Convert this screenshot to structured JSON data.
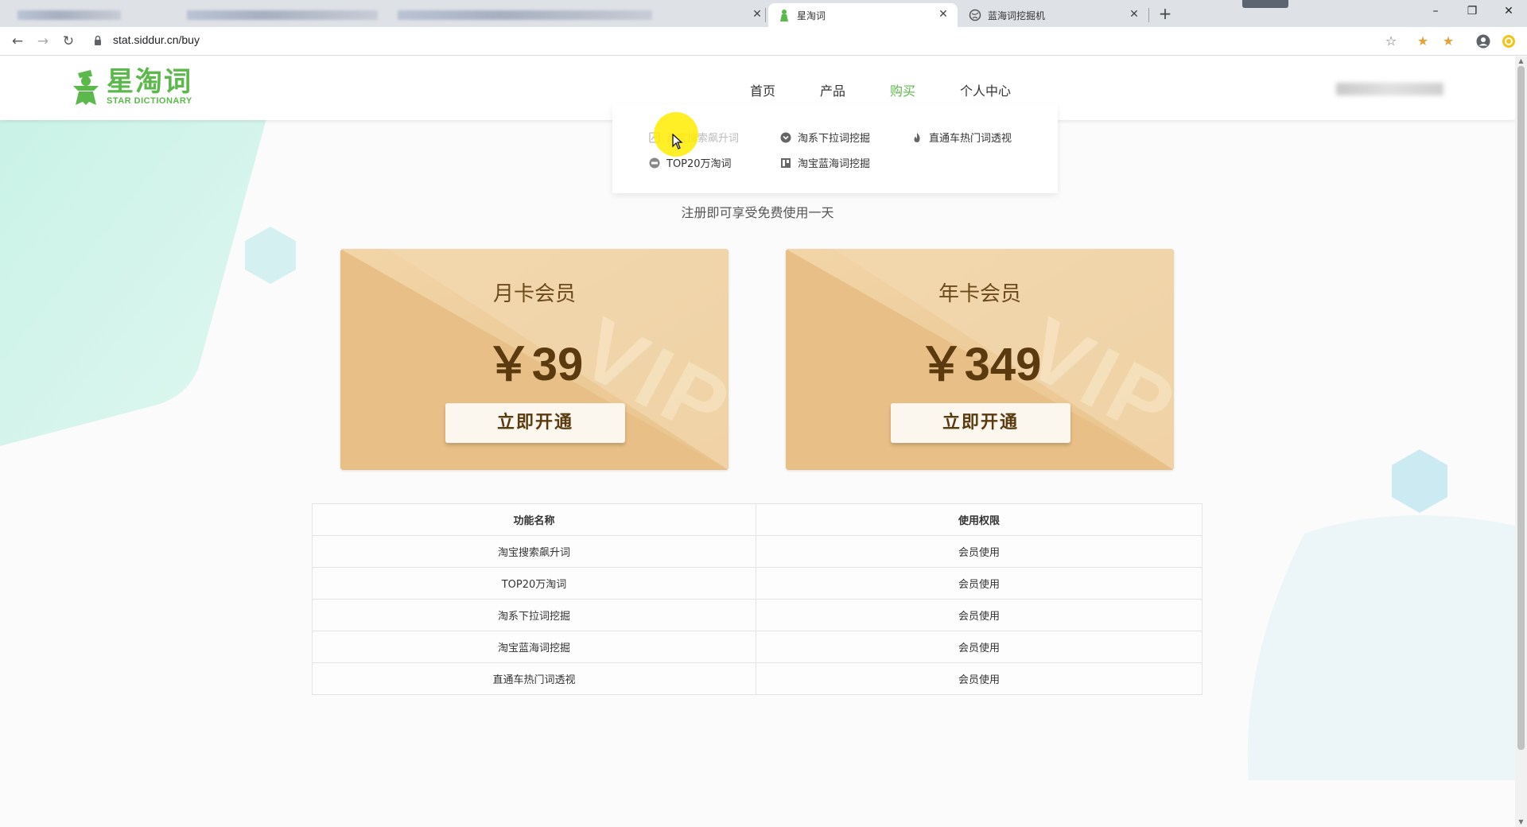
{
  "browser": {
    "tabs": [
      {
        "title": "",
        "blurred": true
      },
      {
        "title": "星淘词",
        "active": true
      },
      {
        "title": "蓝海词挖掘机",
        "active": false
      }
    ],
    "new_tab_symbol": "+",
    "window_controls": [
      "–",
      "❐",
      "✕"
    ],
    "url": "stat.siddur.cn/buy"
  },
  "header": {
    "logo_cn": "星淘词",
    "logo_en": "STAR DICTIONARY",
    "nav": [
      {
        "label": "首页",
        "active": false
      },
      {
        "label": "产品",
        "active": false
      },
      {
        "label": "购买",
        "active": true
      },
      {
        "label": "个人中心",
        "active": false
      }
    ]
  },
  "dropdown": {
    "items": [
      {
        "label": "淘宝搜索飙升词",
        "icon": "chart-icon"
      },
      {
        "label": "淘系下拉词挖掘",
        "icon": "chevron-circle-icon"
      },
      {
        "label": "直通车热门词透视",
        "icon": "fire-icon"
      },
      {
        "label": "TOP20万淘词",
        "icon": "top-badge-icon"
      },
      {
        "label": "淘宝蓝海词挖掘",
        "icon": "grid-icon"
      }
    ]
  },
  "notice": "注册即可享受免费使用一天",
  "plans": [
    {
      "title": "月卡会员",
      "price": "￥39",
      "watermark": "VIP",
      "button": "立即开通"
    },
    {
      "title": "年卡会员",
      "price": "￥349",
      "watermark": "VIP",
      "button": "立即开通"
    }
  ],
  "feature_table": {
    "headers": [
      "功能名称",
      "使用权限"
    ],
    "rows": [
      [
        "淘宝搜索飙升词",
        "会员使用"
      ],
      [
        "TOP20万淘词",
        "会员使用"
      ],
      [
        "淘系下拉词挖掘",
        "会员使用"
      ],
      [
        "淘宝蓝海词挖掘",
        "会员使用"
      ],
      [
        "直通车热门词透视",
        "会员使用"
      ]
    ]
  },
  "colors": {
    "brand_green": "#5bb84a",
    "card_gold": "#ebc48e",
    "card_text": "#5b3a10",
    "bg_teal": "#c8f1e6"
  }
}
